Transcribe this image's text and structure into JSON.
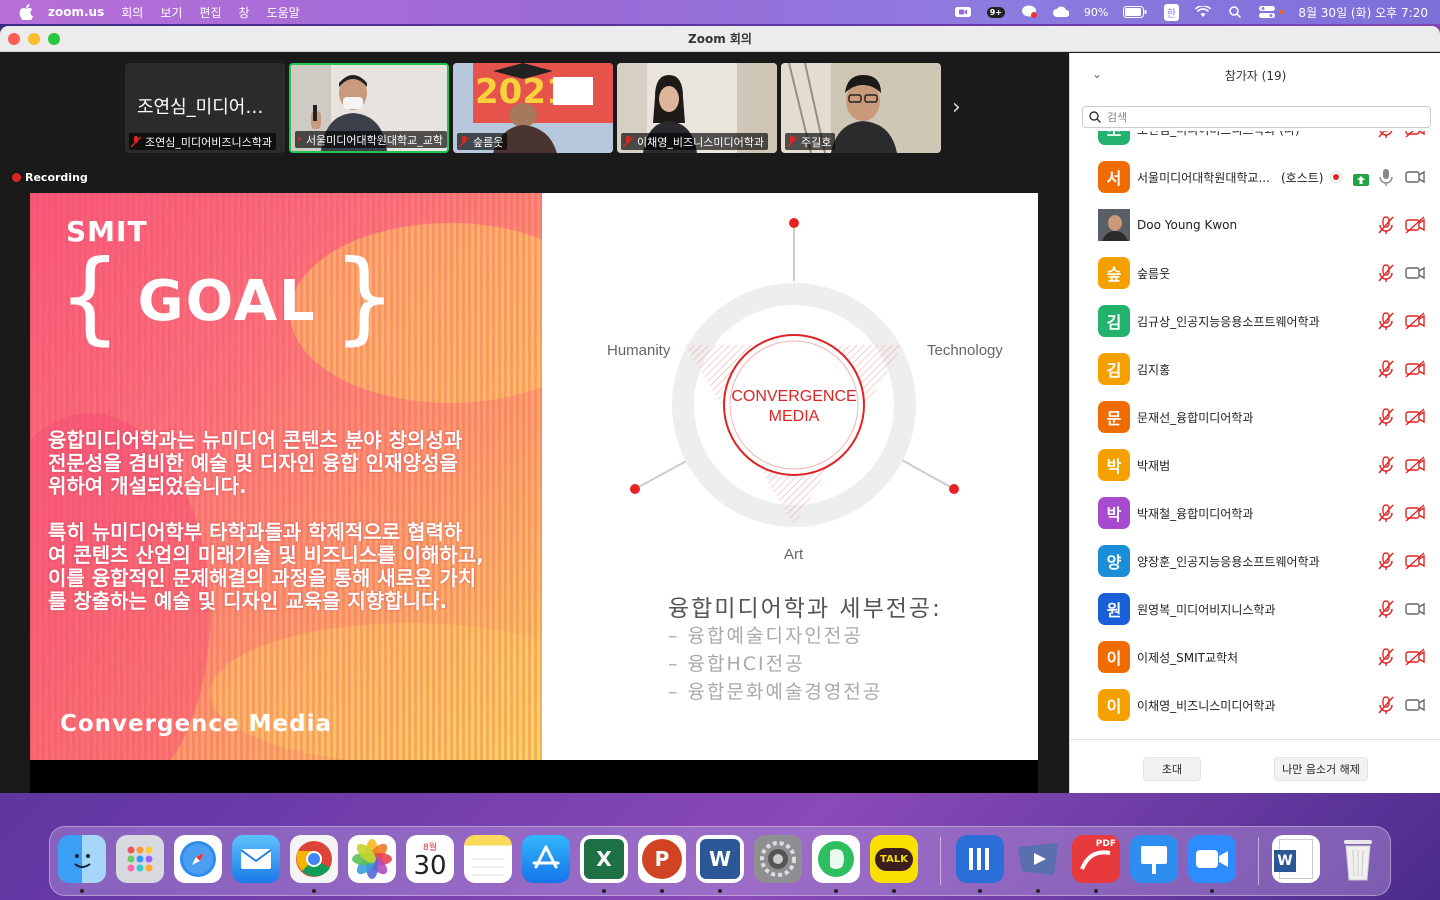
{
  "menubar": {
    "app": "zoom.us",
    "items": [
      "회의",
      "보기",
      "편집",
      "창",
      "도움말"
    ],
    "notification_badge": "9+",
    "battery": "90%",
    "input_method": "한",
    "datetime": "8월 30일 (화) 오후 7:20"
  },
  "window": {
    "title": "Zoom 회의"
  },
  "thumbnails": [
    {
      "big_name": "조연심_미디어…",
      "label": "조연심_미디어비즈니스학과",
      "muted": true
    },
    {
      "label": "서울미디어대학원대학교_교학",
      "muted": true,
      "active": true
    },
    {
      "label": "숲름웃",
      "muted": true
    },
    {
      "label": "이채영_비즈니스미디어학과",
      "muted": true
    },
    {
      "label": "주길호",
      "muted": true
    }
  ],
  "recording": "Recording",
  "slide": {
    "logo": "SMIT",
    "goal": "GOAL",
    "brace_open": "{",
    "brace_close": "}",
    "para1": "융합미디어학과는 뉴미디어 콘텐츠 분야 창의성과\n전문성을 겸비한 예술 및 디자인 융합 인재양성을\n위하여 개설되었습니다.",
    "para2": "특히 뉴미디어학부 타학과들과 학제적으로 협력하\n여 콘텐츠 산업의 미래기술 및 비즈니스를 이해하고,\n이를 융합적인 문제해결의 과정을 통해 새로운 가치\n를 창출하는 예술 및 디자인 교육을 지향합니다.",
    "footer": "Convergence Media",
    "diagram": {
      "humanity": "Humanity",
      "technology": "Technology",
      "art": "Art",
      "center_line1": "CONVERGENCE",
      "center_line2": "MEDIA"
    },
    "majors_title": "융합미디어학과 세부전공:",
    "majors": [
      "– 융합예술디자인전공",
      "– 융합HCI전공",
      "– 융합문화예술경영전공"
    ]
  },
  "participants": {
    "title": "참가자 (19)",
    "search_placeholder": "검색",
    "host_tag": "(호스트)",
    "list": [
      {
        "initial": "조",
        "name": "조연심_미디어비즈니스학과 (나)",
        "color": "#23b26d",
        "cam_off": true
      },
      {
        "initial": "서",
        "name": "서울미디어대학원대학교...",
        "color": "#ef6c00",
        "host": true,
        "mic_muted": false,
        "cam_off": false
      },
      {
        "initial": "",
        "name": "Doo Young Kwon",
        "color": "#444444",
        "photo": true,
        "cam_off": true
      },
      {
        "initial": "숲",
        "name": "숲름웃",
        "color": "#f4a100",
        "cam_off": false
      },
      {
        "initial": "김",
        "name": "김규상_인공지능응용소프트웨어학과",
        "color": "#23b26d",
        "cam_off": true
      },
      {
        "initial": "김",
        "name": "김지홍",
        "color": "#f4a100",
        "cam_off": true
      },
      {
        "initial": "문",
        "name": "문재선_융합미디어학과",
        "color": "#ef6c00",
        "cam_off": true
      },
      {
        "initial": "박",
        "name": "박재범",
        "color": "#f4a100",
        "cam_off": true
      },
      {
        "initial": "박",
        "name": "박재철_융합미디어학과",
        "color": "#a64bd0",
        "cam_off": true
      },
      {
        "initial": "양",
        "name": "양장훈_인공지능응용소프트웨어학과",
        "color": "#1a8fd8",
        "cam_off": true
      },
      {
        "initial": "원",
        "name": "원영복_미디어비지니스학과",
        "color": "#1a5fd8",
        "cam_off": false
      },
      {
        "initial": "이",
        "name": "이제성_SMIT교학처",
        "color": "#ef6c00",
        "cam_off": true
      },
      {
        "initial": "이",
        "name": "이채영_비즈니스미디어학과",
        "color": "#f4a100",
        "cam_off": false
      }
    ],
    "invite": "초대",
    "unmute_me": "나만 음소거 해제"
  },
  "dock": {
    "calendar_month": "8월",
    "calendar_day": "30",
    "talk": "TALK",
    "pdf": "PDF",
    "excel": "X",
    "word": "W",
    "ppt": "P",
    "apps": [
      "finder",
      "launchpad",
      "safari",
      "mail",
      "chrome",
      "photos",
      "calendar",
      "notes",
      "app-store",
      "excel",
      "powerpoint",
      "word",
      "system-preferences",
      "evernote",
      "kakaotalk",
      "files",
      "keynote-remote",
      "pdf-expert",
      "keynote",
      "zoom",
      "word-doc",
      "trash"
    ]
  }
}
